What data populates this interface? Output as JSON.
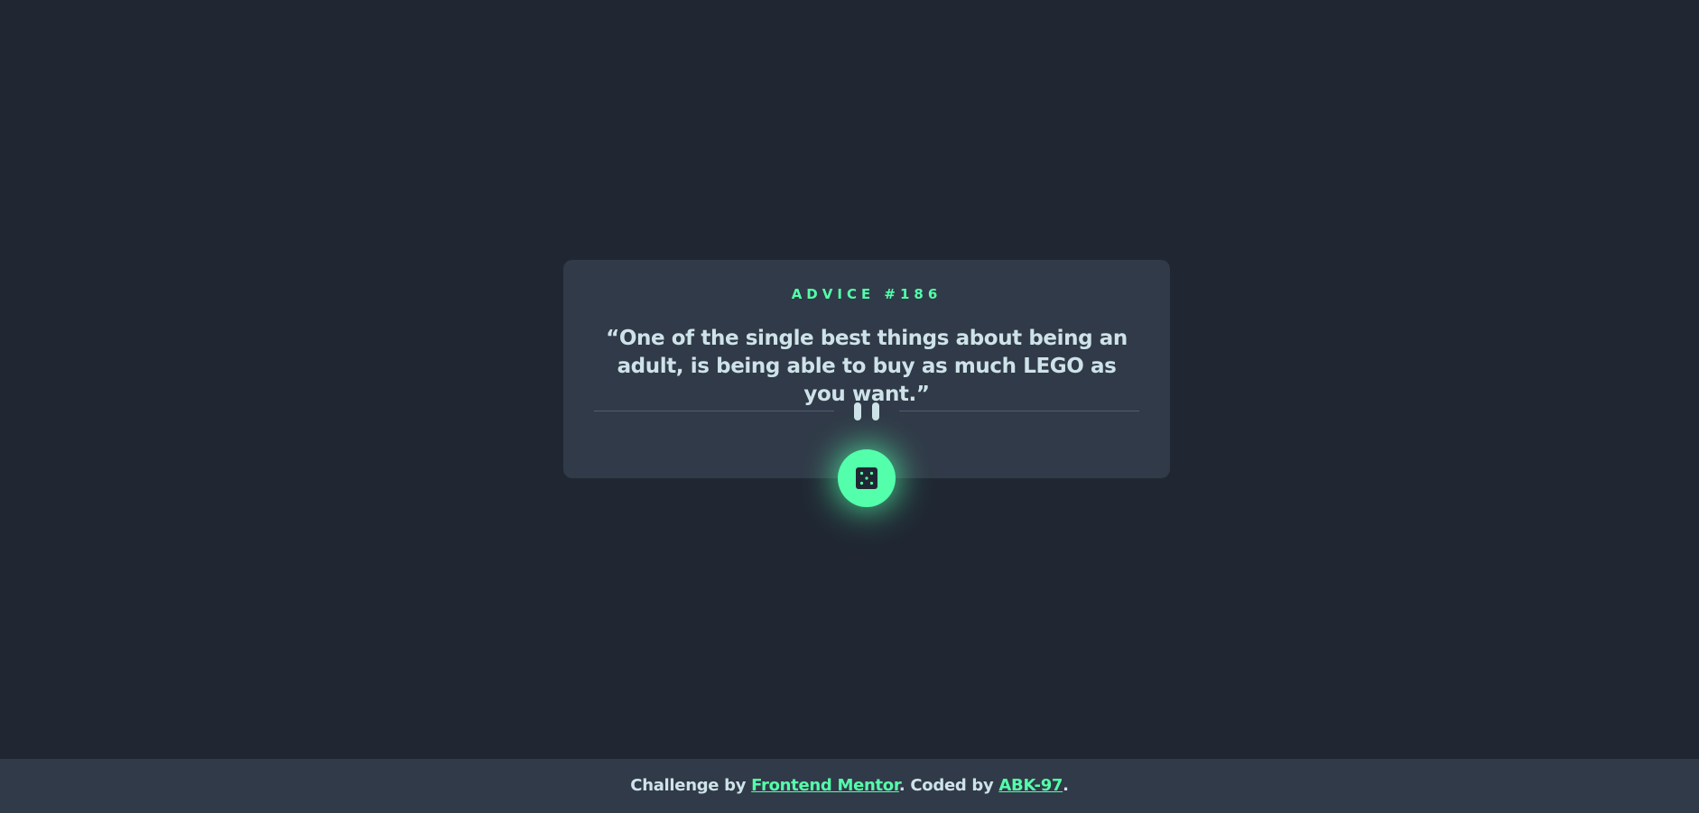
{
  "advice": {
    "id_label": "ADVICE #186",
    "quote": "“One of the single best things about being an adult, is being able to buy as much LEGO as you want.”"
  },
  "button": {
    "icon": "dice-icon"
  },
  "footer": {
    "prefix": "Challenge by ",
    "challenge_link": "Frontend Mentor",
    "middle": ". Coded by ",
    "author_link": "ABK-97",
    "suffix": "."
  },
  "colors": {
    "background": "#202733",
    "card": "#313a48",
    "accent": "#53ffaa",
    "text": "#cee3e9",
    "divider": "#4f5d74"
  }
}
